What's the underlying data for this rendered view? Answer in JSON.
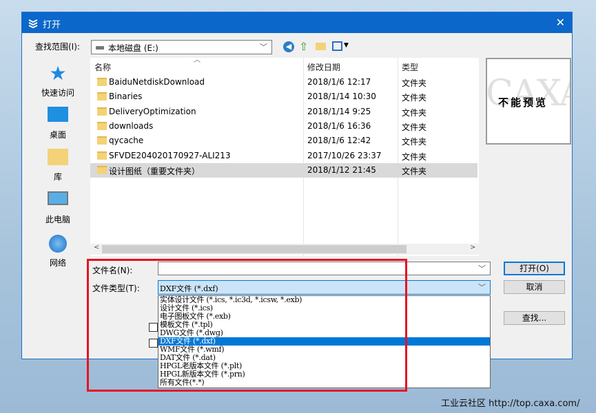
{
  "dialog": {
    "title": "打开",
    "close": "✕"
  },
  "lookin": {
    "label": "查找范围(I):",
    "value": "本地磁盘 (E:)"
  },
  "sidebar": [
    {
      "label": "快速访问"
    },
    {
      "label": "桌面"
    },
    {
      "label": "库"
    },
    {
      "label": "此电脑"
    },
    {
      "label": "网络"
    }
  ],
  "columns": {
    "name": "名称",
    "date": "修改日期",
    "type": "类型"
  },
  "files": [
    {
      "name": "BaiduNetdiskDownload",
      "date": "2018/1/6 12:17",
      "type": "文件夹"
    },
    {
      "name": "Binaries",
      "date": "2018/1/14 10:30",
      "type": "文件夹"
    },
    {
      "name": "DeliveryOptimization",
      "date": "2018/1/14 9:25",
      "type": "文件夹"
    },
    {
      "name": "downloads",
      "date": "2018/1/6 16:36",
      "type": "文件夹"
    },
    {
      "name": "qycache",
      "date": "2018/1/6 12:42",
      "type": "文件夹"
    },
    {
      "name": "SFVDE204020170927-ALI213",
      "date": "2017/10/26 23:37",
      "type": "文件夹"
    },
    {
      "name": "设计图纸（重要文件夹）",
      "date": "2018/1/12 21:45",
      "type": "文件夹"
    }
  ],
  "preview": {
    "text": "不能预览",
    "watermark": "CAXA"
  },
  "filename": {
    "label": "文件名(N):",
    "value": ""
  },
  "filetype": {
    "label": "文件类型(T):",
    "value": "DXF文件 (*.dxf)",
    "options": [
      "实体设计文件 (*.ics, *.ic3d, *.icsw, *.exb)",
      "设计文件 (*.ics)",
      "电子图板文件 (*.exb)",
      "模板文件 (*.tpl)",
      "DWG文件 (*.dwg)",
      "DXF文件 (*.dxf)",
      "WMF文件 (*.wmf)",
      "DAT文件 (*.dat)",
      "HPGL老版本文件 (*.plt)",
      "HPGL新版本文件 (*.prn)",
      "所有文件(*.*)"
    ],
    "selected_index": 5
  },
  "buttons": {
    "open": "打开(O)",
    "cancel": "取消",
    "find": "查找..."
  },
  "footer": {
    "watermark": "工业云社区 http://top.caxa.com/"
  },
  "colors": {
    "accent": "#0078d7",
    "highlight": "#e81123"
  }
}
